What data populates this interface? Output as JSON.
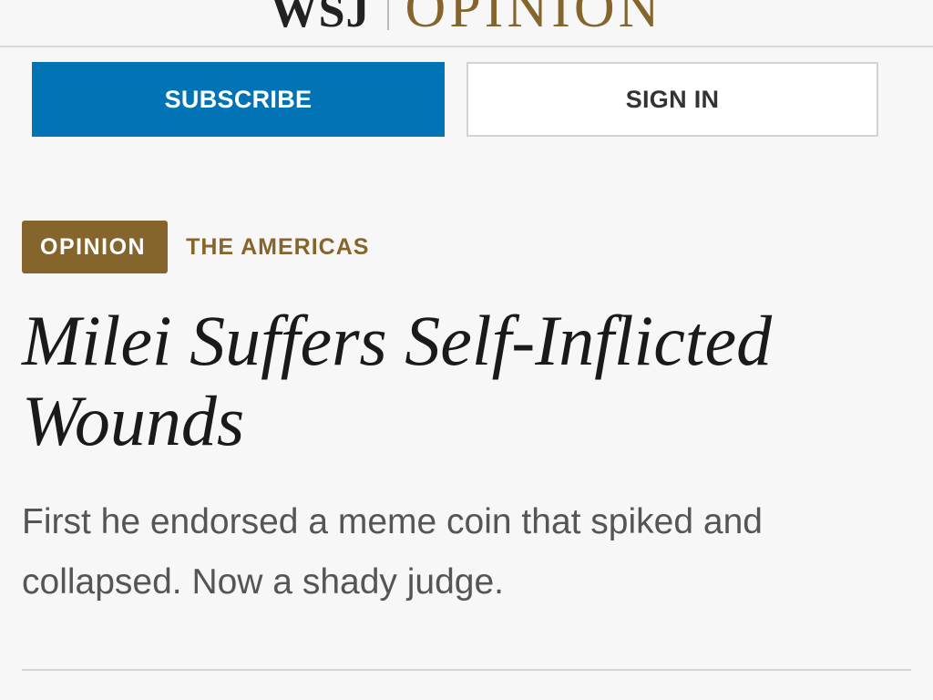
{
  "masthead": {
    "brand": "WSJ",
    "section": "OPINION"
  },
  "actions": {
    "subscribe_label": "SUBSCRIBE",
    "signin_label": "SIGN IN"
  },
  "article": {
    "badge": "OPINION",
    "category": "THE AMERICAS",
    "headline": "Milei Suffers Self-Inflicted Wounds",
    "dek": "First he endorsed a meme coin that spiked and collapsed. Now a shady judge."
  },
  "colors": {
    "accent_gold": "#86652d",
    "subscribe_blue": "#0274b6"
  },
  "icons": {
    "menu": "hamburger-menu-icon"
  }
}
